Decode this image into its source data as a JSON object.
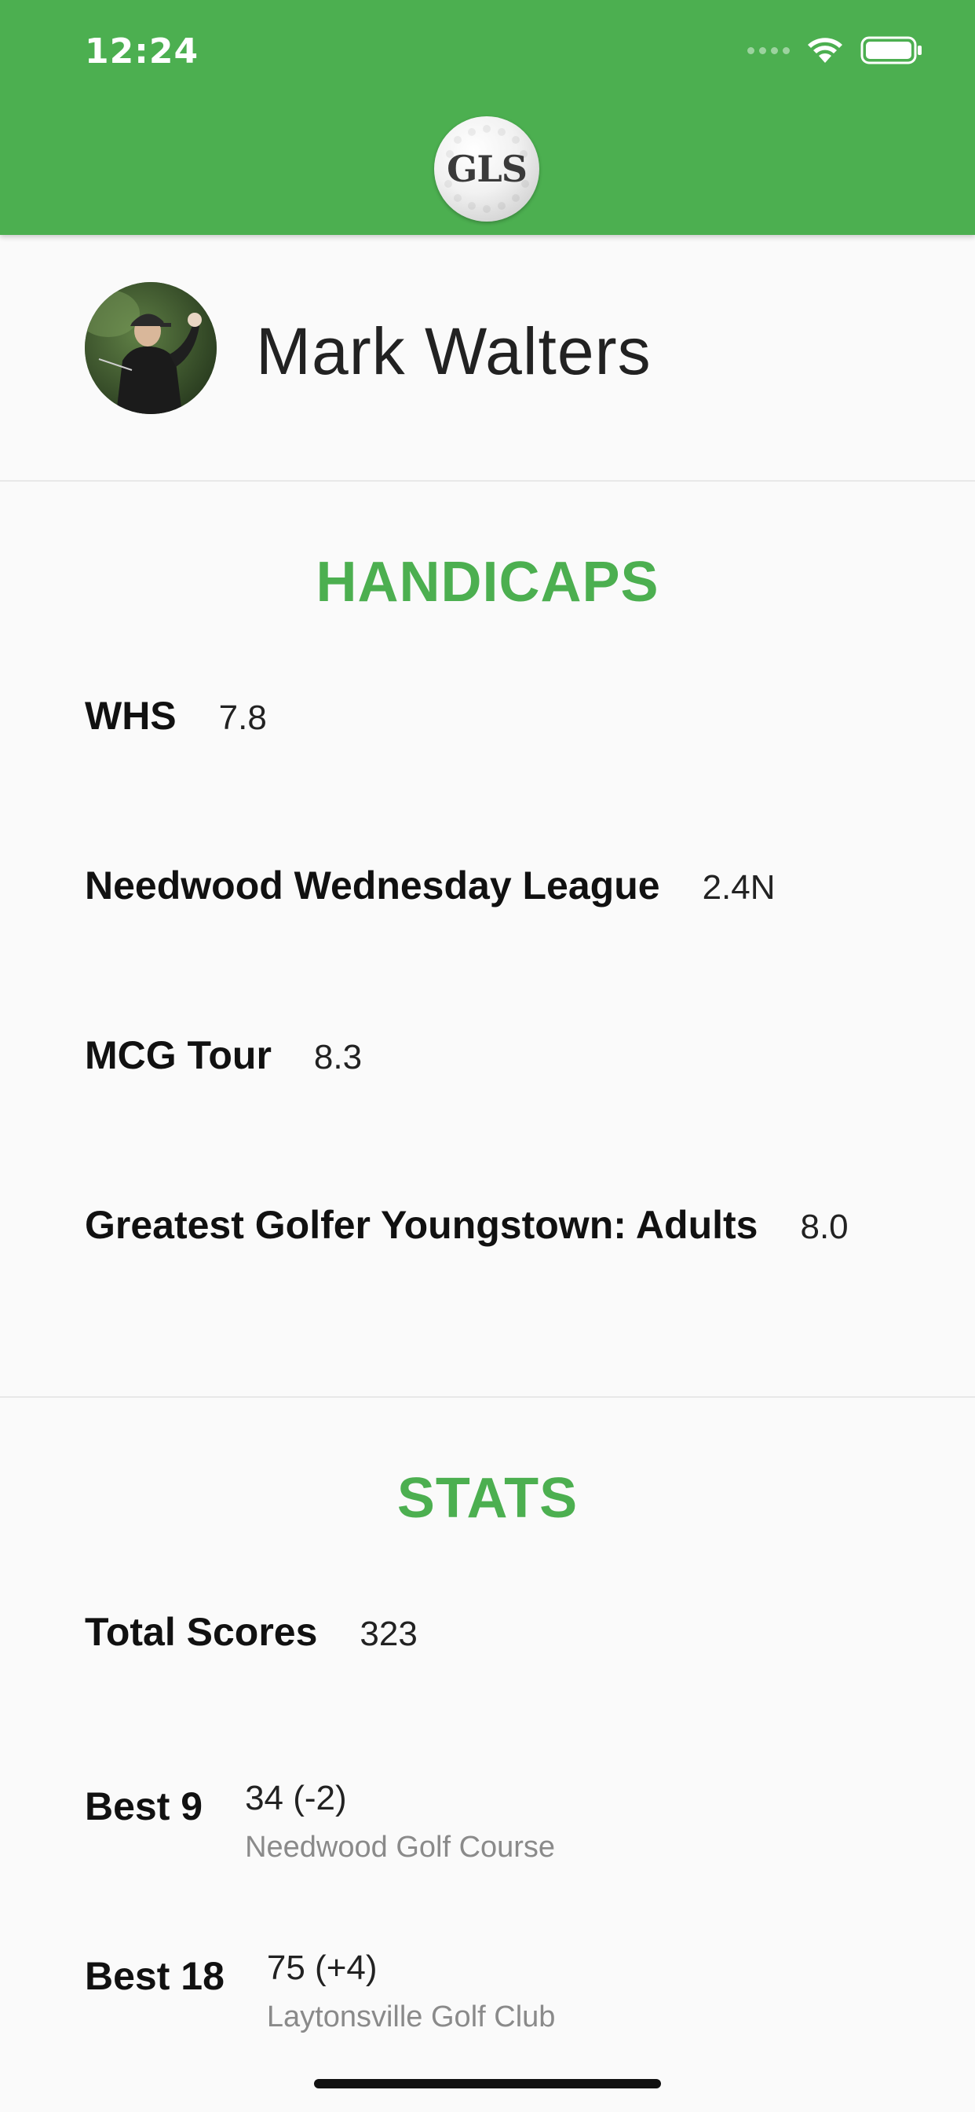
{
  "status_bar": {
    "time": "12:24"
  },
  "header": {
    "logo_text": "GLS",
    "background_color": "#4caf50"
  },
  "profile": {
    "name": "Mark Walters"
  },
  "handicaps": {
    "title": "HANDICAPS",
    "items": [
      {
        "label": "WHS",
        "value": "7.8"
      },
      {
        "label": "Needwood Wednesday League",
        "value": "2.4N"
      },
      {
        "label": "MCG Tour",
        "value": "8.3"
      },
      {
        "label": "Greatest Golfer Youngstown: Adults",
        "value": "8.0"
      }
    ]
  },
  "stats": {
    "title": "STATS",
    "items": [
      {
        "label": "Total Scores",
        "value": "323"
      },
      {
        "label": "Best 9",
        "value": "34 (-2)",
        "sub": "Needwood Golf Course"
      },
      {
        "label": "Best 18",
        "value": "75 (+4)",
        "sub": "Laytonsville Golf Club"
      }
    ]
  },
  "colors": {
    "accent": "#4caf50",
    "background": "#fafafa",
    "text": "#111111",
    "muted": "#8a8a8a"
  }
}
